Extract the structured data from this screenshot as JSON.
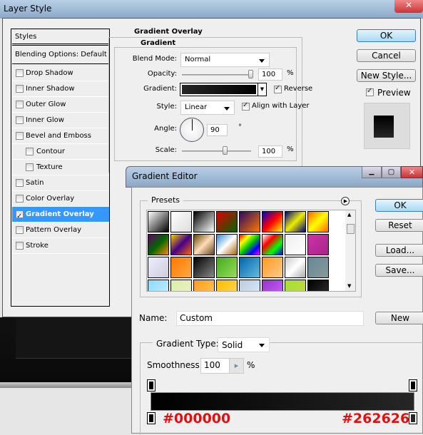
{
  "layer_style": {
    "title": "Layer Style",
    "styles_header": "Styles",
    "blending": "Blending Options: Default",
    "items": [
      {
        "label": "Drop Shadow",
        "checked": false,
        "indent": false
      },
      {
        "label": "Inner Shadow",
        "checked": false,
        "indent": false
      },
      {
        "label": "Outer Glow",
        "checked": false,
        "indent": false
      },
      {
        "label": "Inner Glow",
        "checked": false,
        "indent": false
      },
      {
        "label": "Bevel and Emboss",
        "checked": false,
        "indent": false
      },
      {
        "label": "Contour",
        "checked": false,
        "indent": true
      },
      {
        "label": "Texture",
        "checked": false,
        "indent": true
      },
      {
        "label": "Satin",
        "checked": false,
        "indent": false
      },
      {
        "label": "Color Overlay",
        "checked": false,
        "indent": false
      },
      {
        "label": "Gradient Overlay",
        "checked": true,
        "indent": false,
        "selected": true
      },
      {
        "label": "Pattern Overlay",
        "checked": false,
        "indent": false
      },
      {
        "label": "Stroke",
        "checked": false,
        "indent": false
      }
    ],
    "group_title": "Gradient Overlay",
    "subgroup_title": "Gradient",
    "blend_mode_label": "Blend Mode:",
    "blend_mode": "Normal",
    "opacity_label": "Opacity:",
    "opacity": "100",
    "opacity_unit": "%",
    "gradient_label": "Gradient:",
    "reverse_label": "Reverse",
    "reverse": true,
    "style_label": "Style:",
    "style": "Linear",
    "align_label": "Align with Layer",
    "align": true,
    "angle_label": "Angle:",
    "angle": "90",
    "angle_unit": "°",
    "scale_label": "Scale:",
    "scale": "100",
    "scale_unit": "%",
    "ok": "OK",
    "cancel": "Cancel",
    "new_style": "New Style...",
    "preview_label": "Preview",
    "preview": true
  },
  "gradient_editor": {
    "title": "Gradient Editor",
    "presets_label": "Presets",
    "presets": [
      [
        "#fff",
        "#000"
      ],
      [
        "#fff",
        "#ddd"
      ],
      [
        "#000",
        "#fff"
      ],
      [
        "#d00",
        "#060"
      ],
      [
        "#2a0a60",
        "#f70"
      ],
      [
        "#00c",
        "#f00",
        "#ff0"
      ],
      [
        "#008",
        "#ee0",
        "#008"
      ],
      [
        "#f60",
        "#ff0",
        "#f60"
      ],
      [
        "#606",
        "#060",
        "#f80"
      ],
      [
        "#fc0",
        "#408",
        "#f60"
      ],
      [
        "#640",
        "#fdb",
        "#642"
      ],
      [
        "#38c",
        "#fff",
        "#a60"
      ],
      [
        "#f00",
        "#ff0",
        "#0c0",
        "#00f",
        "#f0f"
      ],
      [
        "#fff",
        "#f00",
        "#0f0",
        "#00f"
      ],
      [
        "#eee",
        "#fff"
      ],
      [
        "#c3a",
        "#a28"
      ],
      [
        "#eef",
        "#ccd"
      ],
      [
        "#f70",
        "#fa4"
      ],
      [
        "#000",
        "#888"
      ],
      [
        "#4a2",
        "#9d5"
      ],
      [
        "#06a",
        "#6bd"
      ],
      [
        "#f92",
        "#fc8"
      ],
      [
        "#ccc",
        "#fff",
        "#aaa"
      ],
      [
        "#689",
        "#899"
      ],
      [
        "#8df",
        "#cef"
      ],
      [
        "#dea",
        "#eec"
      ],
      [
        "#f92",
        "#fc5"
      ],
      [
        "#fb0",
        "#fd5"
      ],
      [
        "#bcd",
        "#def"
      ],
      [
        "#93c",
        "#c6f"
      ],
      [
        "#ad3",
        "#bd4"
      ],
      [
        "#000",
        "#333"
      ]
    ],
    "ok": "OK",
    "reset": "Reset",
    "load": "Load...",
    "save": "Save...",
    "new": "New",
    "name_label": "Name:",
    "name": "Custom",
    "type_label": "Gradient Type:",
    "type": "Solid",
    "smoothness_label": "Smoothness:",
    "smoothness": "100",
    "smoothness_unit": "%",
    "stop_left": "#000000",
    "stop_right": "#262626"
  }
}
